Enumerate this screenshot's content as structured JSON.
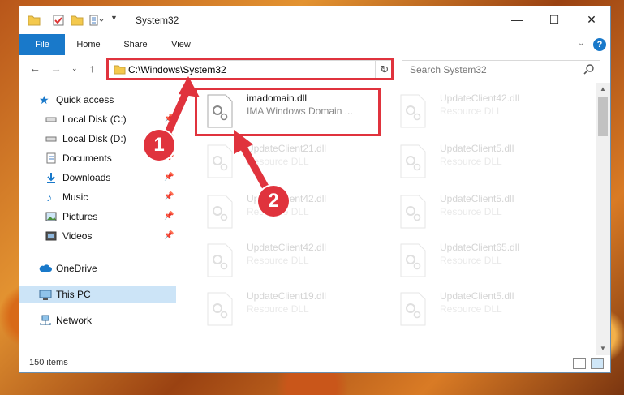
{
  "window": {
    "title": "System32",
    "controls": {
      "minimize": "—",
      "maximize": "☐",
      "close": "✕"
    }
  },
  "ribbon": {
    "tabs": [
      "File",
      "Home",
      "Share",
      "View"
    ]
  },
  "address": {
    "path": "C:\\Windows\\System32",
    "search_placeholder": "Search System32"
  },
  "nav_pane": {
    "items": [
      {
        "label": "Quick access",
        "icon": "star-icon"
      },
      {
        "label": "Local Disk (C:)",
        "icon": "drive-icon"
      },
      {
        "label": "Local Disk (D:)",
        "icon": "drive-icon"
      },
      {
        "label": "Documents",
        "icon": "documents-icon"
      },
      {
        "label": "Downloads",
        "icon": "download-icon"
      },
      {
        "label": "Music",
        "icon": "music-icon"
      },
      {
        "label": "Pictures",
        "icon": "pictures-icon"
      },
      {
        "label": "Videos",
        "icon": "videos-icon"
      },
      {
        "label": "OneDrive",
        "icon": "cloud-icon"
      },
      {
        "label": "This PC",
        "icon": "computer-icon"
      },
      {
        "label": "Network",
        "icon": "network-icon"
      }
    ]
  },
  "files": [
    {
      "name": "imadomain.dll",
      "desc": "IMA Windows Domain ..."
    },
    {
      "name": "UpdateClient42.dll",
      "desc": "Resource DLL"
    },
    {
      "name": "UpdateClient21.dll",
      "desc": "Resource DLL"
    },
    {
      "name": "UpdateClient5.dll",
      "desc": "Resource DLL"
    },
    {
      "name": "UpdateClient42.dll",
      "desc": "Resource DLL"
    },
    {
      "name": "UpdateClient5.dll",
      "desc": "Resource DLL"
    },
    {
      "name": "UpdateClient42.dll",
      "desc": "Resource DLL"
    },
    {
      "name": "UpdateClient65.dll",
      "desc": "Resource DLL"
    },
    {
      "name": "UpdateClient19.dll",
      "desc": "Resource DLL"
    },
    {
      "name": "UpdateClient5.dll",
      "desc": "Resource DLL"
    }
  ],
  "status": {
    "item_count": "150 items"
  },
  "annotations": {
    "step1": "1",
    "step2": "2"
  },
  "colors": {
    "accent": "#1979ca",
    "highlight": "#e0333d",
    "selection": "#cce4f7"
  }
}
